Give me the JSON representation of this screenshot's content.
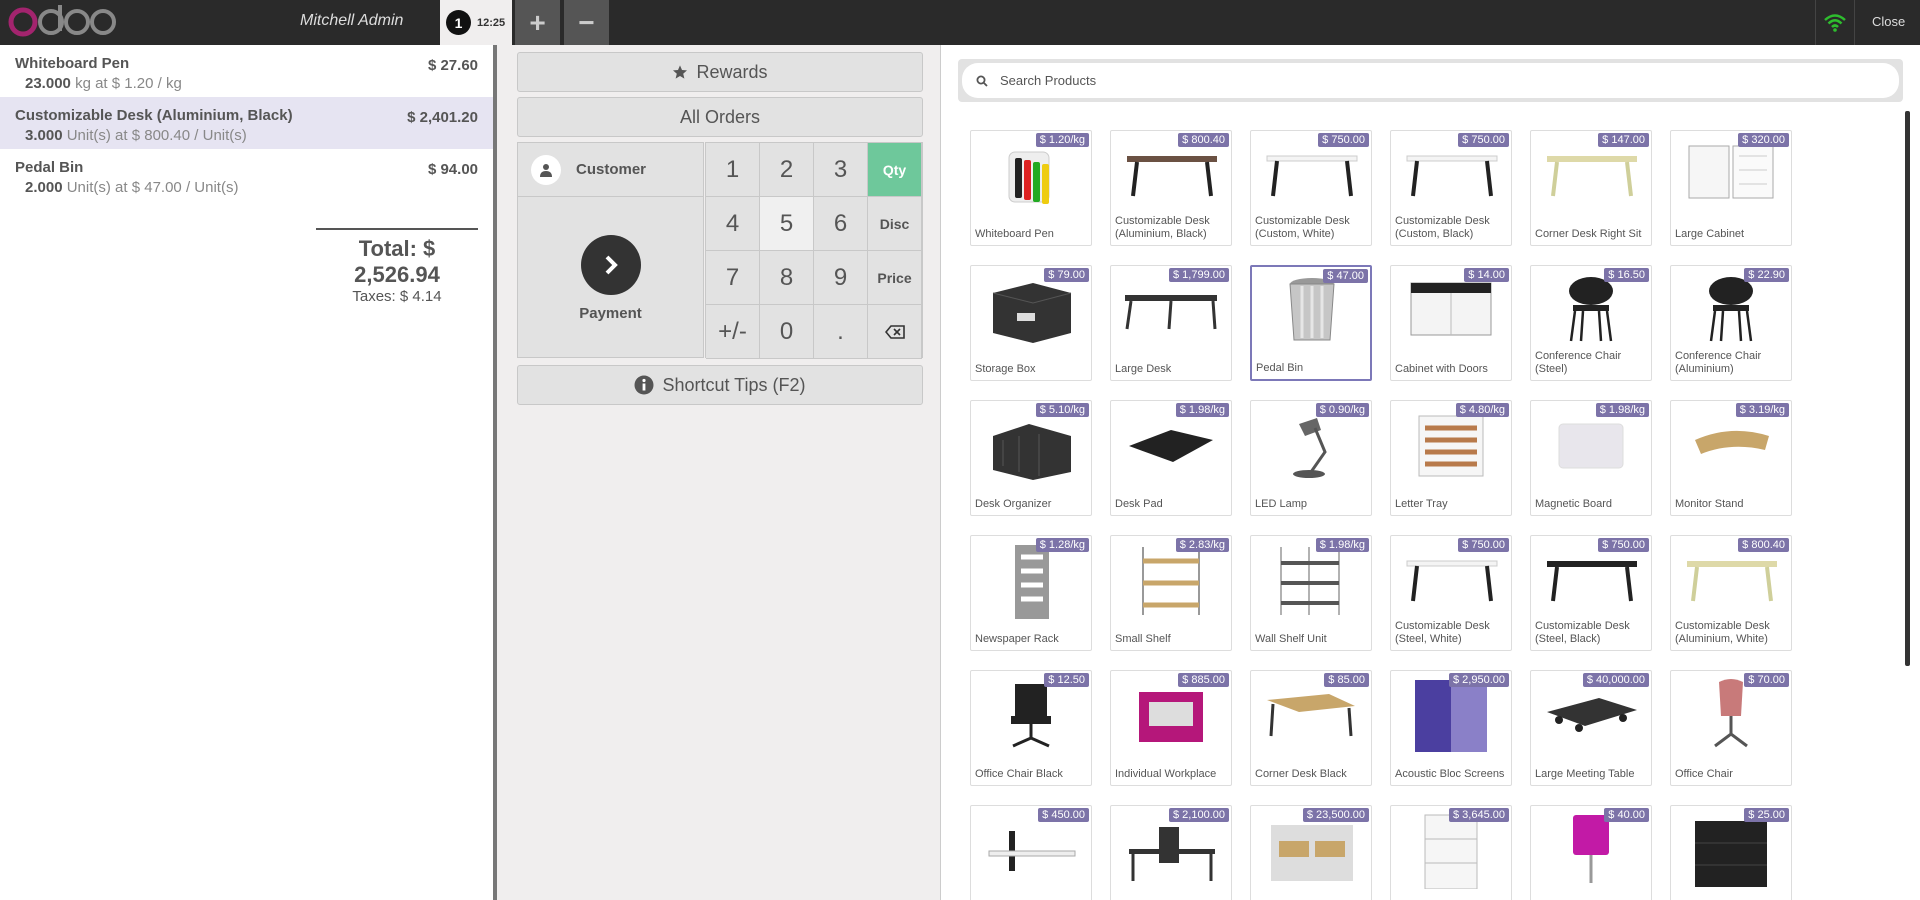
{
  "header": {
    "cashier": "Mitchell Admin",
    "order_number": "1",
    "order_time": "12:25",
    "add_label": "+",
    "remove_label": "−",
    "close_label": "Close"
  },
  "orderlines": [
    {
      "name": "Whiteboard Pen",
      "price": "$ 27.60",
      "qty": "23.000",
      "detail": "kg at $ 1.20 / kg",
      "selected": false
    },
    {
      "name": "Customizable Desk (Aluminium, Black)",
      "price": "$ 2,401.20",
      "qty": "3.000",
      "detail": "Unit(s) at $ 800.40 / Unit(s)",
      "selected": true
    },
    {
      "name": "Pedal Bin",
      "price": "$ 94.00",
      "qty": "2.000",
      "detail": "Unit(s) at $ 47.00 / Unit(s)",
      "selected": false
    }
  ],
  "summary": {
    "total": "Total: $ 2,526.94",
    "taxes": "Taxes: $ 4.14"
  },
  "controls": {
    "rewards": "Rewards",
    "all_orders": "All Orders",
    "customer": "Customer",
    "payment": "Payment",
    "shortcut_tips": "Shortcut Tips (F2)"
  },
  "numpad": [
    "1",
    "2",
    "3",
    "Qty",
    "4",
    "5",
    "6",
    "Disc",
    "7",
    "8",
    "9",
    "Price",
    "+/-",
    "0",
    ".",
    "⌫"
  ],
  "search": {
    "placeholder": "Search Products"
  },
  "products": [
    {
      "name": "Whiteboard Pen",
      "price": "$ 1.20/kg",
      "icon": "pens"
    },
    {
      "name": "Customizable Desk (Aluminium, Black)",
      "price": "$ 800.40",
      "icon": "desk-brown"
    },
    {
      "name": "Customizable Desk (Custom, White)",
      "price": "$ 750.00",
      "icon": "desk-white"
    },
    {
      "name": "Customizable Desk (Custom, Black)",
      "price": "$ 750.00",
      "icon": "desk-white"
    },
    {
      "name": "Corner Desk Right Sit",
      "price": "$ 147.00",
      "icon": "desk-cream"
    },
    {
      "name": "Large Cabinet",
      "price": "$ 320.00",
      "icon": "cabinet"
    },
    {
      "name": "Storage Box",
      "price": "$ 79.00",
      "icon": "box"
    },
    {
      "name": "Large Desk",
      "price": "$ 1,799.00",
      "icon": "large-desk"
    },
    {
      "name": "Pedal Bin",
      "price": "$ 47.00",
      "icon": "bin"
    },
    {
      "name": "Cabinet with Doors",
      "price": "$ 14.00",
      "icon": "cabinet-doors"
    },
    {
      "name": "Conference Chair (Steel)",
      "price": "$ 16.50",
      "icon": "chair-black"
    },
    {
      "name": "Conference Chair (Aluminium)",
      "price": "$ 22.90",
      "icon": "chair-black"
    },
    {
      "name": "Desk Organizer",
      "price": "$ 5.10/kg",
      "icon": "organizer"
    },
    {
      "name": "Desk Pad",
      "price": "$ 1.98/kg",
      "icon": "pad"
    },
    {
      "name": "LED Lamp",
      "price": "$ 0.90/kg",
      "icon": "lamp"
    },
    {
      "name": "Letter Tray",
      "price": "$ 4.80/kg",
      "icon": "tray"
    },
    {
      "name": "Magnetic Board",
      "price": "$ 1.98/kg",
      "icon": "board"
    },
    {
      "name": "Monitor Stand",
      "price": "$ 3.19/kg",
      "icon": "stand"
    },
    {
      "name": "Newspaper Rack",
      "price": "$ 1.28/kg",
      "icon": "rack"
    },
    {
      "name": "Small Shelf",
      "price": "$ 2.83/kg",
      "icon": "shelf"
    },
    {
      "name": "Wall Shelf Unit",
      "price": "$ 1.98/kg",
      "icon": "wall-shelf"
    },
    {
      "name": "Customizable Desk (Steel, White)",
      "price": "$ 750.00",
      "icon": "desk-white"
    },
    {
      "name": "Customizable Desk (Steel, Black)",
      "price": "$ 750.00",
      "icon": "desk-black"
    },
    {
      "name": "Customizable Desk (Aluminium, White)",
      "price": "$ 800.40",
      "icon": "desk-cream"
    },
    {
      "name": "Office Chair Black",
      "price": "$ 12.50",
      "icon": "office-chair"
    },
    {
      "name": "Individual Workplace",
      "price": "$ 885.00",
      "icon": "workplace"
    },
    {
      "name": "Corner Desk Black",
      "price": "$ 85.00",
      "icon": "corner-desk"
    },
    {
      "name": "Acoustic Bloc Screens",
      "price": "$ 2,950.00",
      "icon": "screens"
    },
    {
      "name": "Large Meeting Table",
      "price": "$ 40,000.00",
      "icon": "meeting"
    },
    {
      "name": "Office Chair",
      "price": "$ 70.00",
      "icon": "pink-chair"
    },
    {
      "name": "",
      "price": "$ 450.00",
      "icon": "desk-divider"
    },
    {
      "name": "",
      "price": "$ 2,100.00",
      "icon": "desk-divider2"
    },
    {
      "name": "",
      "price": "$ 23,500.00",
      "icon": "office-set"
    },
    {
      "name": "",
      "price": "$ 3,645.00",
      "icon": "drawers"
    },
    {
      "name": "",
      "price": "$ 40.00",
      "icon": "pink-lamp"
    },
    {
      "name": "",
      "price": "$ 25.00",
      "icon": "black-drawer"
    }
  ],
  "colors": {
    "accent": "#7c73a8",
    "active_key": "#6ec89b",
    "selected_line": "#e6e4f2",
    "logo": "#a3246e",
    "wifi": "#2ebd2e"
  }
}
